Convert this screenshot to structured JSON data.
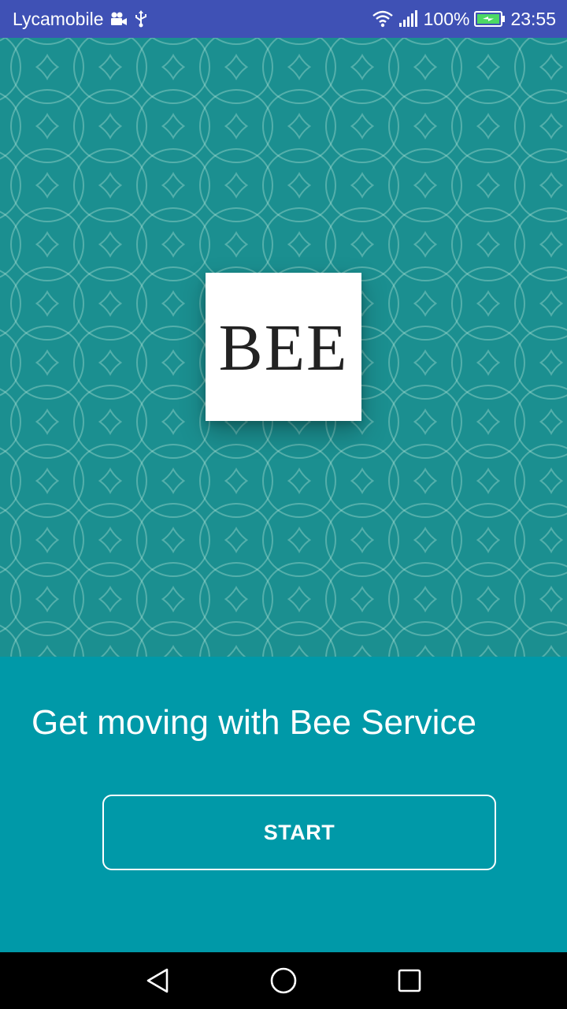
{
  "status_bar": {
    "carrier": "Lycamobile",
    "battery": "100%",
    "time": "23:55",
    "icons": [
      "video-camera-icon",
      "usb-icon",
      "wifi-icon",
      "signal-icon",
      "battery-charging-icon"
    ],
    "background": "#3f51b5"
  },
  "hero": {
    "logo_text": "BEE",
    "background": "#1b8f90"
  },
  "panel": {
    "tagline": "Get moving with Bee Service",
    "start_label": "START",
    "background": "#0099a8"
  },
  "nav_bar": {
    "icons": [
      "back-icon",
      "home-icon",
      "recents-icon"
    ]
  }
}
